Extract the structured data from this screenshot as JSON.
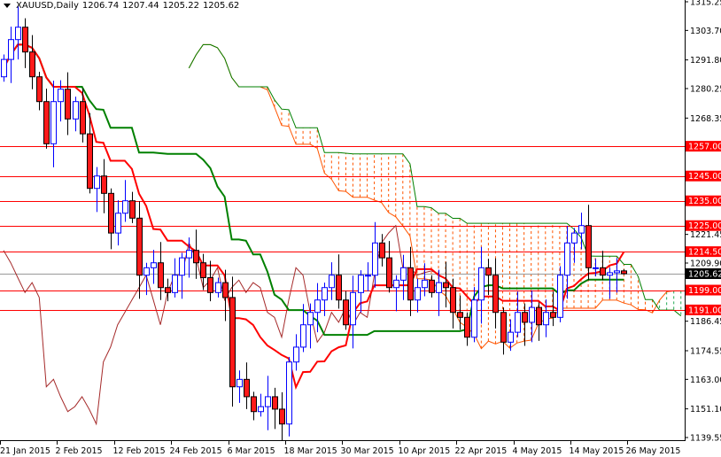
{
  "header": {
    "symbol": "XAUUSD,Daily",
    "open": "1206.74",
    "high": "1207.44",
    "low": "1205.22",
    "close": "1205.62"
  },
  "colors": {
    "bull": "#0000ff",
    "bear": "#ff1a1a",
    "tenkan": "#ff0000",
    "kijun": "#008000",
    "chikou": "#a52a2a",
    "cloud_bear": "#ff5500",
    "cloud_bull": "#22aa55",
    "level": "#ff0000",
    "current": "#000000"
  },
  "chart_data": {
    "type": "candlestick",
    "title": "XAUUSD,Daily",
    "ylim": [
      1139.55,
      1315.25
    ],
    "y_ticks": [
      "1315.25",
      "1303.70",
      "1291.80",
      "1280.25",
      "1268.35",
      "1221.45",
      "1209.90",
      "1186.45",
      "1174.55",
      "1163.00",
      "1151.10",
      "1139.55"
    ],
    "x_ticks": [
      {
        "bar": 0,
        "label": "21 Jan 2015"
      },
      {
        "bar": 8,
        "label": "2 Feb 2015"
      },
      {
        "bar": 16,
        "label": "12 Feb 2015"
      },
      {
        "bar": 24,
        "label": "24 Feb 2015"
      },
      {
        "bar": 32,
        "label": "6 Mar 2015"
      },
      {
        "bar": 40,
        "label": "18 Mar 2015"
      },
      {
        "bar": 48,
        "label": "30 Mar 2015"
      },
      {
        "bar": 56,
        "label": "10 Apr 2015"
      },
      {
        "bar": 64,
        "label": "22 Apr 2015"
      },
      {
        "bar": 72,
        "label": "4 May 2015"
      },
      {
        "bar": 80,
        "label": "14 May 2015"
      },
      {
        "bar": 88,
        "label": "26 May 2015"
      }
    ],
    "first_open": 1285,
    "closes": [
      1292,
      1300,
      1305,
      1295,
      1285,
      1275,
      1258,
      1275,
      1280,
      1268,
      1275,
      1262,
      1240,
      1245,
      1238,
      1222,
      1230,
      1235,
      1228,
      1205,
      1208,
      1210,
      1200,
      1198,
      1205,
      1212,
      1215,
      1210,
      1204,
      1198,
      1202,
      1196,
      1160,
      1163,
      1156,
      1150,
      1152,
      1156,
      1151,
      1145,
      1170,
      1176,
      1185,
      1190,
      1195,
      1200,
      1205,
      1195,
      1185,
      1198,
      1205,
      1205,
      1218,
      1212,
      1200,
      1203,
      1208,
      1195,
      1200,
      1203,
      1198,
      1202,
      1200,
      1190,
      1188,
      1180,
      1195,
      1208,
      1205,
      1190,
      1178,
      1182,
      1190,
      1186,
      1192,
      1185,
      1190,
      1188,
      1205,
      1218,
      1222,
      1225,
      1208,
      1208,
      1205,
      1206,
      1206.74,
      1205.62
    ],
    "last_bar": {
      "open": 1206.74,
      "high": 1207.44,
      "low": 1205.22,
      "close": 1205.62
    },
    "levels": [
      {
        "price": 1257.0,
        "label": "1257.00"
      },
      {
        "price": 1245.0,
        "label": "1245.00"
      },
      {
        "price": 1235.0,
        "label": "1235.00"
      },
      {
        "price": 1225.0,
        "label": "1225.00"
      },
      {
        "price": 1214.5,
        "label": "1214.50"
      },
      {
        "price": 1199.0,
        "label": "1199.00"
      },
      {
        "price": 1191.0,
        "label": "1191.00"
      }
    ],
    "current_price": {
      "price": 1205.62,
      "label": "1205.62"
    },
    "indicator": "Ichimoku Kinko Hyo (9,26,52)"
  }
}
